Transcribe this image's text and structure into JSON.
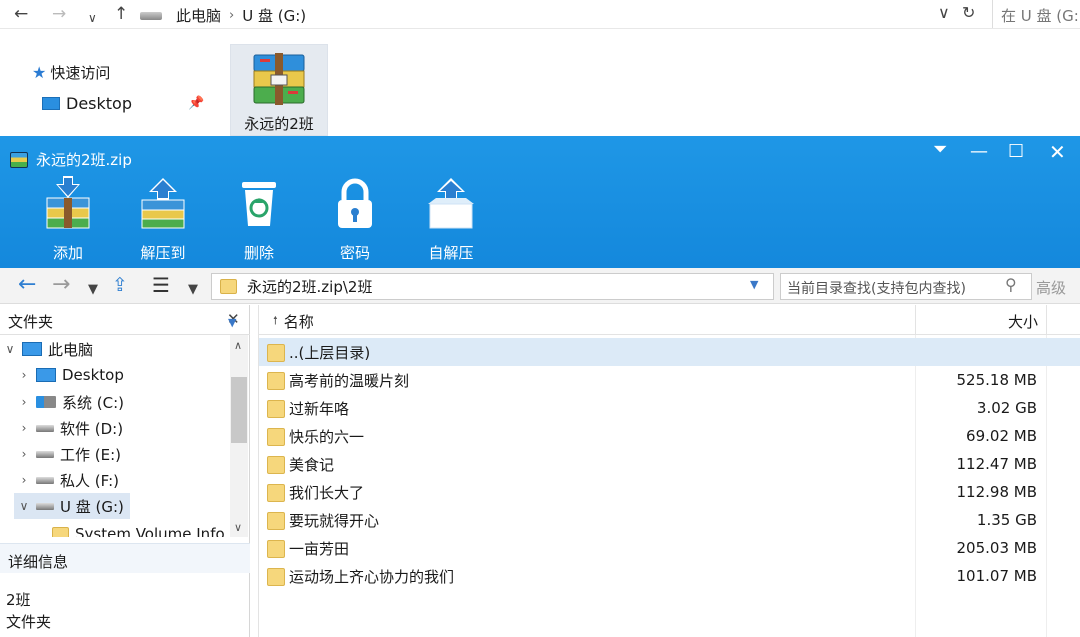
{
  "explorer": {
    "breadcrumb": [
      "此电脑",
      "U 盘 (G:)"
    ],
    "search_placeholder": "在 U 盘 (G:",
    "quick_access": "快速访问",
    "desktop": "Desktop",
    "archive_file_label": "永远的2班"
  },
  "rar": {
    "title": "永远的2班.zip",
    "toolbar": [
      {
        "label": "添加",
        "icon": "add-archive-icon"
      },
      {
        "label": "解压到",
        "icon": "extract-to-icon"
      },
      {
        "label": "删除",
        "icon": "delete-icon"
      },
      {
        "label": "密码",
        "icon": "password-lock-icon"
      },
      {
        "label": "自解压",
        "icon": "self-extract-icon"
      }
    ],
    "path": "永远的2班.zip\\2班",
    "find_placeholder": "当前目录查找(支持包内查找)",
    "advanced": "高级",
    "folders_pane": {
      "header": "文件夹",
      "tree": [
        "此电脑",
        "Desktop",
        "系统 (C:)",
        "软件 (D:)",
        "工作 (E:)",
        "私人 (F:)",
        "U 盘 (G:)",
        "System Volume Info"
      ]
    },
    "details": {
      "header": "详细信息",
      "name": "2班",
      "type": "文件夹"
    },
    "columns": {
      "name": "名称",
      "size": "大小"
    },
    "rows": [
      {
        "name": "..(上层目录)",
        "size": ""
      },
      {
        "name": "高考前的温暖片刻",
        "size": "525.18 MB"
      },
      {
        "name": "过新年咯",
        "size": "3.02 GB"
      },
      {
        "name": "快乐的六一",
        "size": "69.02 MB"
      },
      {
        "name": "美食记",
        "size": "112.47 MB"
      },
      {
        "name": "我们长大了",
        "size": "112.98 MB"
      },
      {
        "name": "要玩就得开心",
        "size": "1.35 GB"
      },
      {
        "name": "一亩芳田",
        "size": "205.03 MB"
      },
      {
        "name": "运动场上齐心协力的我们",
        "size": "101.07 MB"
      }
    ]
  },
  "colors": {
    "titlebar": "#1488dc",
    "selection": "#dceaf7",
    "folder": "#f6d77c"
  }
}
